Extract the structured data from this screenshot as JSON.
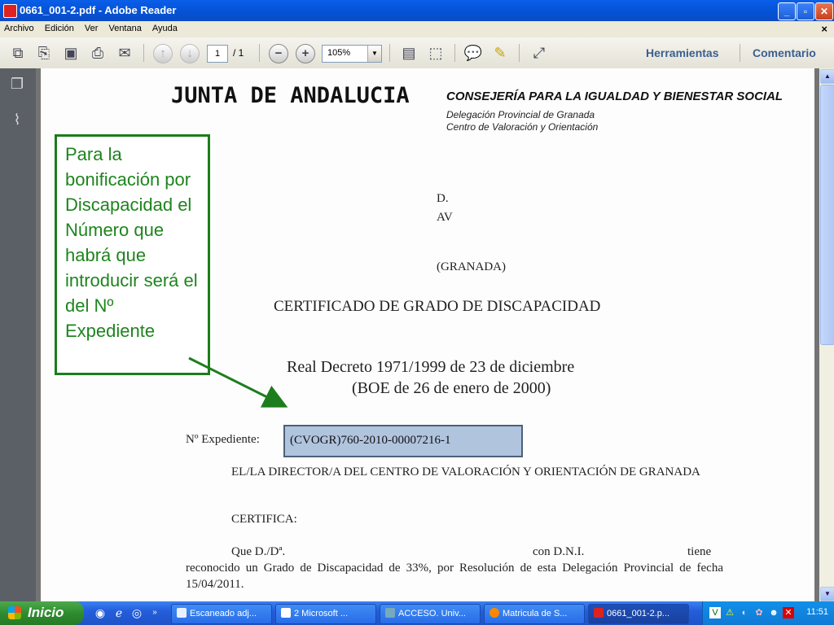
{
  "window": {
    "title": "0661_001-2.pdf - Adobe Reader",
    "minimize": "_",
    "restore": "▫",
    "close": "✕"
  },
  "menu": {
    "items": [
      "Archivo",
      "Edición",
      "Ver",
      "Ventana",
      "Ayuda"
    ],
    "close_doc": "×"
  },
  "toolbar": {
    "page_current": "1",
    "page_total": "/ 1",
    "zoom": "105%",
    "herramientas": "Herramientas",
    "comentario": "Comentario"
  },
  "document": {
    "junta": "JUNTA DE ANDALUCIA",
    "consejeria": "CONSEJERÍA PARA LA IGUALDAD Y BIENESTAR SOCIAL",
    "delegacion": "Delegación Provincial de Granada",
    "centro": "Centro de Valoración y Orientación",
    "addr_d": "D.",
    "addr_av": "AV",
    "addr_granada": "(GRANADA)",
    "cert_title": "CERTIFICADO DE GRADO DE DISCAPACIDAD",
    "decree": "Real Decreto 1971/1999 de 23 de diciembre",
    "boe": "(BOE de 26 de enero de 2000)",
    "exp_label": "Nº Expediente:",
    "exp_value": "(CVOGR)760-2010-00007216-1",
    "director": "EL/LA DIRECTOR/A DEL CENTRO DE VALORACIÓN Y ORIENTACIÓN DE GRANADA",
    "certifica": "CERTIFICA:",
    "que": "Que D./Dª.",
    "dni": "con D.N.I.",
    "tiene": "tiene",
    "reconocido": "reconocido un Grado de Discapacidad de 33%, por Resolución de esta Delegación Provincial de fecha 15/04/2011."
  },
  "annotation": {
    "text": "Para la bonificación por Discapacidad el Número que habrá que introducir será el del Nº Expediente"
  },
  "taskbar": {
    "start": "Inicio",
    "tasks": [
      "Escaneado adj...",
      "2 Microsoft ...",
      "ACCESO. Univ...",
      "Matricula de S...",
      "0661_001-2.p..."
    ],
    "clock": "11:51"
  }
}
